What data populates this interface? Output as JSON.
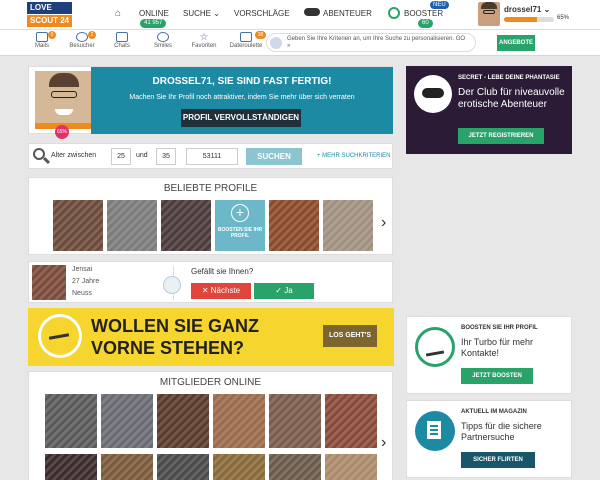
{
  "logo": {
    "line1": "LOVE",
    "line2": "SCOUT 24"
  },
  "nav": {
    "online_label": "ONLINE",
    "online_count": "41 957",
    "suche_label": "SUCHE",
    "vorschlaege_label": "VORSCHLÄGE",
    "abenteuer_label": "ABENTEUER",
    "booster_label": "BOOSTER",
    "booster_badge": "NEU",
    "booster_count": "60"
  },
  "user": {
    "name": "drossel71",
    "progress_text": "65%",
    "progress": 0.65
  },
  "subnav": [
    {
      "label": "Mails",
      "badge": "0"
    },
    {
      "label": "Besucher",
      "badge": "2"
    },
    {
      "label": "Chats",
      "badge": ""
    },
    {
      "label": "Smiles",
      "badge": ""
    },
    {
      "label": "Favoriten",
      "badge": ""
    },
    {
      "label": "Dateroulette",
      "badge": "38"
    }
  ],
  "search_hint": "Geben Sie Ihre Kriterien an, um Ihre Suche zu personalisieren. GO »",
  "angebote_label": "ANGEBOTE",
  "profile_banner": {
    "title": "DROSSEL71, SIE SIND FAST FERTIG!",
    "text": "Machen Sie Ihr Profil noch attraktiver, indem Sie mehr über sich verraten",
    "button": "PROFIL VERVOLLSTÄNDIGEN",
    "percent_badge": "65%"
  },
  "search": {
    "alter_label": "Alter zwischen",
    "from": "25",
    "und_label": "und",
    "to": "35",
    "plz": "53111",
    "button": "SUCHEN",
    "more": "+ MEHR SUCHKRITERIEN"
  },
  "beliebte": {
    "title": "BELIEBTE PROFILE",
    "boost_text": "BOOSTEN SIE IHR PROFIL",
    "photos": [
      "#6b4a3a",
      "#7a7a7a",
      "#4a3a3a",
      "#8a4a2a",
      "#a09080"
    ]
  },
  "match": {
    "name": "Jensai",
    "age": "27 Jahre",
    "city": "Neuss",
    "question": "Gefällt sie Ihnen?",
    "next": "Nächste",
    "yes": "Ja"
  },
  "promo": {
    "line1": "WOLLEN SIE GANZ",
    "line2": "VORNE STEHEN?",
    "button": "LOS GEHT'S"
  },
  "online_members": {
    "title": "MITGLIEDER ONLINE",
    "row1": [
      "#5a5a5a",
      "#6a6a72",
      "#5a3a2a",
      "#9a6a4a",
      "#7a5a4a",
      "#8a4a3a"
    ],
    "row2": [
      "#3a2a2a",
      "#7a5a3a",
      "#4a4a4a",
      "#8a6a3a",
      "#6a5a4a",
      "#aa8a6a"
    ]
  },
  "ad": {
    "kicker": "SECRET - LEBE DEINE PHANTASIE",
    "headline": "Der Club für niveauvolle erotische Abenteuer",
    "button": "JETZT REGISTRIEREN"
  },
  "boost_card": {
    "kicker": "BOOSTEN SIE IHR PROFIL",
    "headline": "Ihr Turbo für mehr Kontakte!",
    "button": "JETZT BOOSTEN"
  },
  "magazin_card": {
    "kicker": "AKTUELL IM MAGAZIN",
    "headline": "Tipps für die sichere Partnersuche",
    "button": "SICHER FLIRTEN"
  },
  "colors": {
    "accent_blue": "#1d8aa3",
    "green": "#29a36a",
    "orange": "#f08a1c",
    "yellow": "#f7d52f",
    "dark_purple": "#2b1b36"
  }
}
